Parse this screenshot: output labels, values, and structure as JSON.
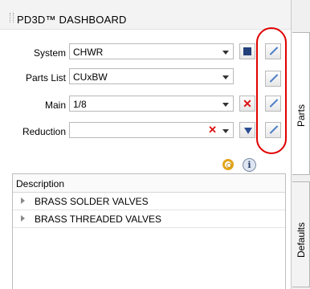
{
  "panel": {
    "title": "PD3D™ DASHBOARD"
  },
  "form": {
    "system": {
      "label": "System",
      "value": "CHWR"
    },
    "parts_list": {
      "label": "Parts List",
      "value": "CUxBW"
    },
    "main": {
      "label": "Main",
      "value": "1/8"
    },
    "reduction": {
      "label": "Reduction",
      "value": ""
    }
  },
  "icons": {
    "clear": "✕",
    "info": "i"
  },
  "tree": {
    "header": "Description",
    "rows": [
      "BRASS SOLDER VALVES",
      "BRASS THREADED VALVES"
    ]
  },
  "tabs": {
    "parts": "Parts",
    "defaults": "Defaults"
  },
  "colors": {
    "highlight": "#e00000",
    "clear": "#dd1111",
    "accent": "#2a4d95"
  }
}
